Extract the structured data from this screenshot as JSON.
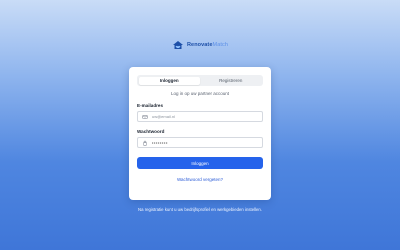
{
  "brand": {
    "name_part1": "Renovate",
    "name_part2": "Match",
    "logo_icon": "house-handshake-icon"
  },
  "auth": {
    "tabs": [
      {
        "label": "Inloggen",
        "active": true
      },
      {
        "label": "Registreren",
        "active": false
      }
    ],
    "subtitle": "Log in op uw partner account",
    "email": {
      "label": "E-mailadres",
      "placeholder": "uw@email.nl",
      "value": "",
      "icon": "mail-icon"
    },
    "password": {
      "label": "Wachtwoord",
      "value": "••••••••",
      "icon": "lock-icon"
    },
    "submit_label": "Inloggen",
    "forgot_label": "Wachtwoord vergeten?"
  },
  "footer_text": "Na registratie kunt u uw bedrijfsprofiel en werkgebieden instellen.",
  "colors": {
    "primary": "#2563eb",
    "brand_dark": "#1d4fa8",
    "brand_light": "#5b8fe8"
  }
}
